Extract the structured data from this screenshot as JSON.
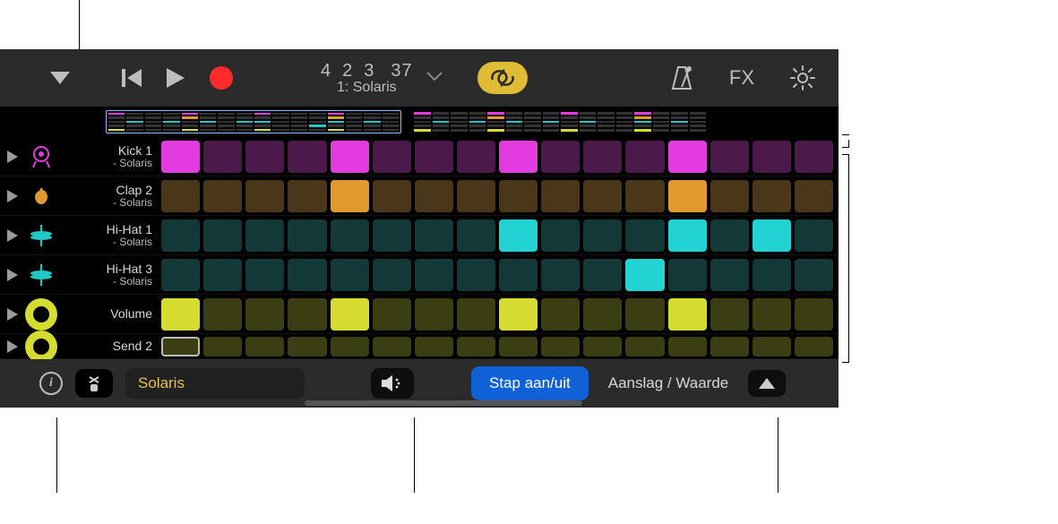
{
  "toolbar": {
    "lcd_numbers": [
      "4",
      "2",
      "3",
      "37"
    ],
    "lcd_name": "1: Solaris",
    "fx_label": "FX"
  },
  "overview": {
    "blocks": [
      {
        "selected": true,
        "rows": [
          [
            "#e23be0",
            "#333",
            "#333",
            "#333",
            "#e23be0",
            "#333",
            "#333",
            "#333",
            "#e23be0",
            "#333",
            "#333",
            "#333",
            "#e23be0",
            "#333",
            "#333",
            "#333"
          ],
          [
            "#333",
            "#333",
            "#333",
            "#333",
            "#e09a2f",
            "#333",
            "#333",
            "#333",
            "#333",
            "#333",
            "#333",
            "#333",
            "#e09a2f",
            "#333",
            "#333",
            "#333"
          ],
          [
            "#333",
            "#20c8c8",
            "#333",
            "#20c8c8",
            "#333",
            "#20c8c8",
            "#333",
            "#20c8c8",
            "#20c8c8",
            "#333",
            "#333",
            "#333",
            "#20c8c8",
            "#333",
            "#20c8c8",
            "#333"
          ],
          [
            "#333",
            "#333",
            "#333",
            "#333",
            "#333",
            "#333",
            "#333",
            "#333",
            "#333",
            "#333",
            "#333",
            "#20c8c8",
            "#333",
            "#333",
            "#333",
            "#333"
          ],
          [
            "#d6dc2f",
            "#333",
            "#333",
            "#333",
            "#d6dc2f",
            "#333",
            "#333",
            "#333",
            "#d6dc2f",
            "#333",
            "#333",
            "#333",
            "#d6dc2f",
            "#333",
            "#333",
            "#333"
          ]
        ]
      },
      {
        "selected": false,
        "rows": [
          [
            "#e23be0",
            "#333",
            "#333",
            "#333",
            "#e23be0",
            "#333",
            "#333",
            "#333",
            "#e23be0",
            "#333",
            "#333",
            "#333",
            "#e23be0",
            "#333",
            "#333",
            "#333"
          ],
          [
            "#333",
            "#333",
            "#333",
            "#333",
            "#e09a2f",
            "#333",
            "#333",
            "#333",
            "#333",
            "#333",
            "#333",
            "#333",
            "#e09a2f",
            "#333",
            "#333",
            "#333"
          ],
          [
            "#333",
            "#20c8c8",
            "#333",
            "#20c8c8",
            "#333",
            "#20c8c8",
            "#333",
            "#20c8c8",
            "#333",
            "#20c8c8",
            "#333",
            "#333",
            "#20c8c8",
            "#333",
            "#20c8c8",
            "#333"
          ],
          [
            "#333",
            "#333",
            "#333",
            "#333",
            "#333",
            "#333",
            "#333",
            "#333",
            "#333",
            "#333",
            "#333",
            "#333",
            "#333",
            "#333",
            "#333",
            "#333"
          ],
          [
            "#d6dc2f",
            "#333",
            "#333",
            "#333",
            "#d6dc2f",
            "#333",
            "#333",
            "#333",
            "#d6dc2f",
            "#333",
            "#333",
            "#333",
            "#d6dc2f",
            "#333",
            "#333",
            "#333"
          ]
        ]
      }
    ]
  },
  "tracks": [
    {
      "name": "kick",
      "label": "Kick 1",
      "sublabel": "- Solaris",
      "icon_bg": "transparent",
      "icon_color": "#e23be0",
      "on_color": "#e23be0",
      "off_color": "#4b1a4a",
      "pattern": [
        1,
        0,
        0,
        0,
        1,
        0,
        0,
        0,
        1,
        0,
        0,
        0,
        1,
        0,
        0,
        0
      ]
    },
    {
      "name": "clap",
      "label": "Clap 2",
      "sublabel": "- Solaris",
      "icon_bg": "transparent",
      "icon_color": "#e09a2f",
      "on_color": "#e09a2f",
      "off_color": "#4a3618",
      "pattern": [
        0,
        0,
        0,
        0,
        1,
        0,
        0,
        0,
        0,
        0,
        0,
        0,
        1,
        0,
        0,
        0
      ]
    },
    {
      "name": "hihat1",
      "label": "Hi-Hat 1",
      "sublabel": "- Solaris",
      "icon_bg": "transparent",
      "icon_color": "#20c8c8",
      "on_color": "#23d3d3",
      "off_color": "#123838",
      "pattern": [
        0,
        0,
        0,
        0,
        0,
        0,
        0,
        0,
        1,
        0,
        0,
        0,
        1,
        0,
        1,
        0
      ]
    },
    {
      "name": "hihat3",
      "label": "Hi-Hat 3",
      "sublabel": "- Solaris",
      "icon_bg": "transparent",
      "icon_color": "#20c8c8",
      "on_color": "#23d3d3",
      "off_color": "#123838",
      "pattern": [
        0,
        0,
        0,
        0,
        0,
        0,
        0,
        0,
        0,
        0,
        0,
        1,
        0,
        0,
        0,
        0
      ]
    },
    {
      "name": "volume",
      "label": "Volume",
      "sublabel": "",
      "icon_bg": "#d6dc2f",
      "icon_color": "#000",
      "on_color": "#d6dc2f",
      "off_color": "#3b3d13",
      "pattern": [
        1,
        0,
        0,
        0,
        1,
        0,
        0,
        0,
        1,
        0,
        0,
        0,
        1,
        0,
        0,
        0
      ]
    },
    {
      "name": "send2",
      "label": "Send 2",
      "sublabel": "",
      "icon_bg": "#d6dc2f",
      "icon_color": "#000",
      "on_color": "#d6dc2f",
      "off_color": "#3b3d13",
      "pattern": [
        0,
        0,
        0,
        0,
        0,
        0,
        0,
        0,
        0,
        0,
        0,
        0,
        0,
        0,
        0,
        0
      ],
      "partial": true
    }
  ],
  "bottom": {
    "kit_name": "Solaris",
    "step_toggle_label": "Stap aan/uit",
    "velocity_label": "Aanslag / Waarde"
  }
}
